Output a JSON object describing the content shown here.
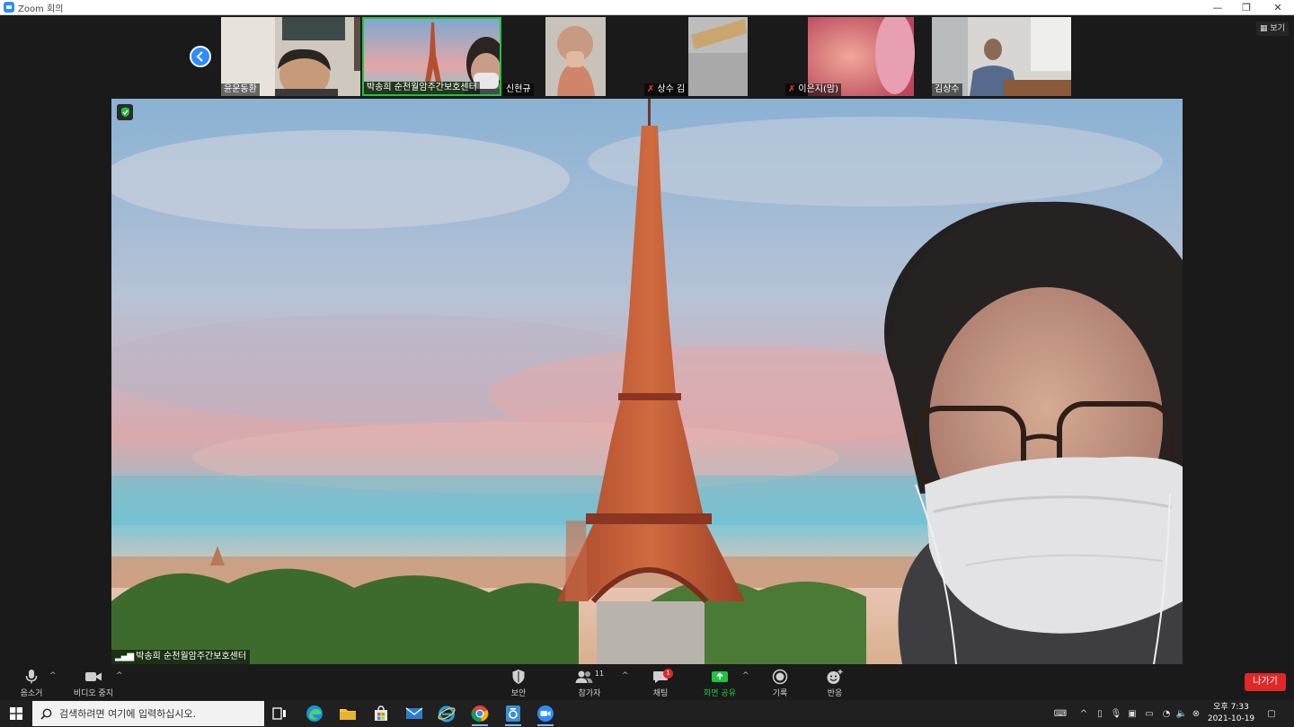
{
  "window": {
    "title": "Zoom 회의",
    "controls": [
      "—",
      "❐",
      "✕"
    ]
  },
  "gallery": {
    "view_label": "보기",
    "participants": [
      {
        "name": "윤운동환",
        "muted": false
      },
      {
        "name": "박송희 순천월암주간보호센터",
        "muted": false,
        "active": true
      },
      {
        "name": "신현규",
        "muted": false
      },
      {
        "name": "상수 김",
        "muted": true
      },
      {
        "name": "이은지(맘)",
        "muted": true
      },
      {
        "name": "김상수",
        "muted": false
      }
    ]
  },
  "main_video": {
    "speaker_name": "박송희 순천월암주간보호센터"
  },
  "toolbar": {
    "mute_label": "음소거",
    "video_label": "비디오 중지",
    "security_label": "보안",
    "participants_label": "참가자",
    "participants_count": "11",
    "chat_label": "채팅",
    "chat_badge": "1",
    "share_label": "화면 공유",
    "record_label": "기록",
    "reactions_label": "반응",
    "leave_label": "나가기"
  },
  "taskbar": {
    "search_placeholder": "검색하려면 여기에 입력하십시오.",
    "clock_time": "오후 7:33",
    "clock_date": "2021-10-19"
  },
  "colors": {
    "zoom_blue": "#2d8cff",
    "share_green": "#1fc342",
    "leave_red": "#e02828"
  }
}
